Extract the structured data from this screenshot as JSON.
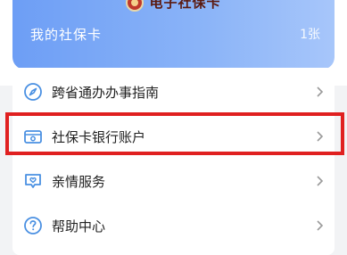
{
  "card": {
    "header_title": "电子社保卡",
    "label": "我的社保卡",
    "count": "1张"
  },
  "menu": {
    "items": [
      {
        "label": "跨省通办办事指南",
        "icon": "compass-icon"
      },
      {
        "label": "社保卡银行账户",
        "icon": "bank-card-icon"
      },
      {
        "label": "亲情服务",
        "icon": "heart-message-icon"
      },
      {
        "label": "帮助中心",
        "icon": "help-icon"
      }
    ]
  },
  "colors": {
    "accent": "#4a90e2",
    "highlight_border": "#e02020",
    "card_gradient_start": "#6d9ef5",
    "card_gradient_end": "#a7c6fa"
  }
}
